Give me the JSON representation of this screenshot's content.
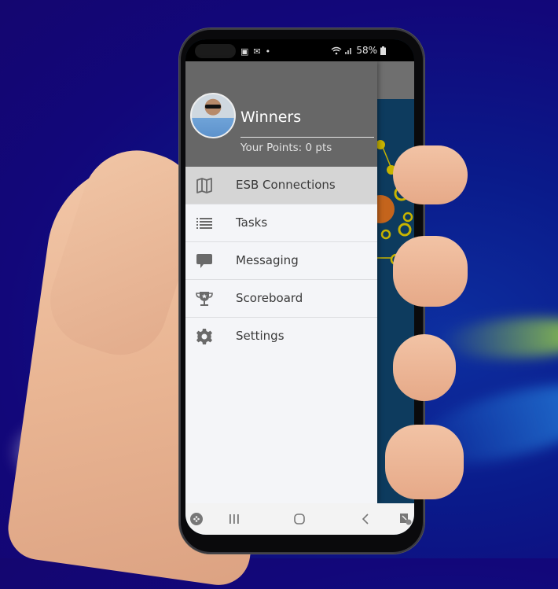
{
  "status_bar": {
    "battery": "58%",
    "notification_icons": [
      "image-icon",
      "mail-icon",
      "dot-icon"
    ],
    "system_icons": [
      "wifi-icon",
      "signal-icon",
      "battery-icon"
    ]
  },
  "drawer": {
    "user": {
      "name": "Winners",
      "points_label": "Your Points: 0 pts"
    },
    "menu": [
      {
        "label": "ESB Connections",
        "icon": "map-icon",
        "active": true
      },
      {
        "label": "Tasks",
        "icon": "list-icon",
        "active": false
      },
      {
        "label": "Messaging",
        "icon": "chat-bubble-icon",
        "active": false
      },
      {
        "label": "Scoreboard",
        "icon": "trophy-icon",
        "active": false
      },
      {
        "label": "Settings",
        "icon": "gear-icon",
        "active": false
      }
    ]
  },
  "nav_bar": {
    "buttons": [
      "game-launcher",
      "recent-apps",
      "home",
      "back",
      "screen-capture"
    ]
  },
  "colors": {
    "drawer_header": "#676767",
    "active_item": "#d5d5d5",
    "drawer_bg": "#f4f5f8",
    "app_bg": "#0d3b5e",
    "accent_yellow": "#c8b400"
  }
}
